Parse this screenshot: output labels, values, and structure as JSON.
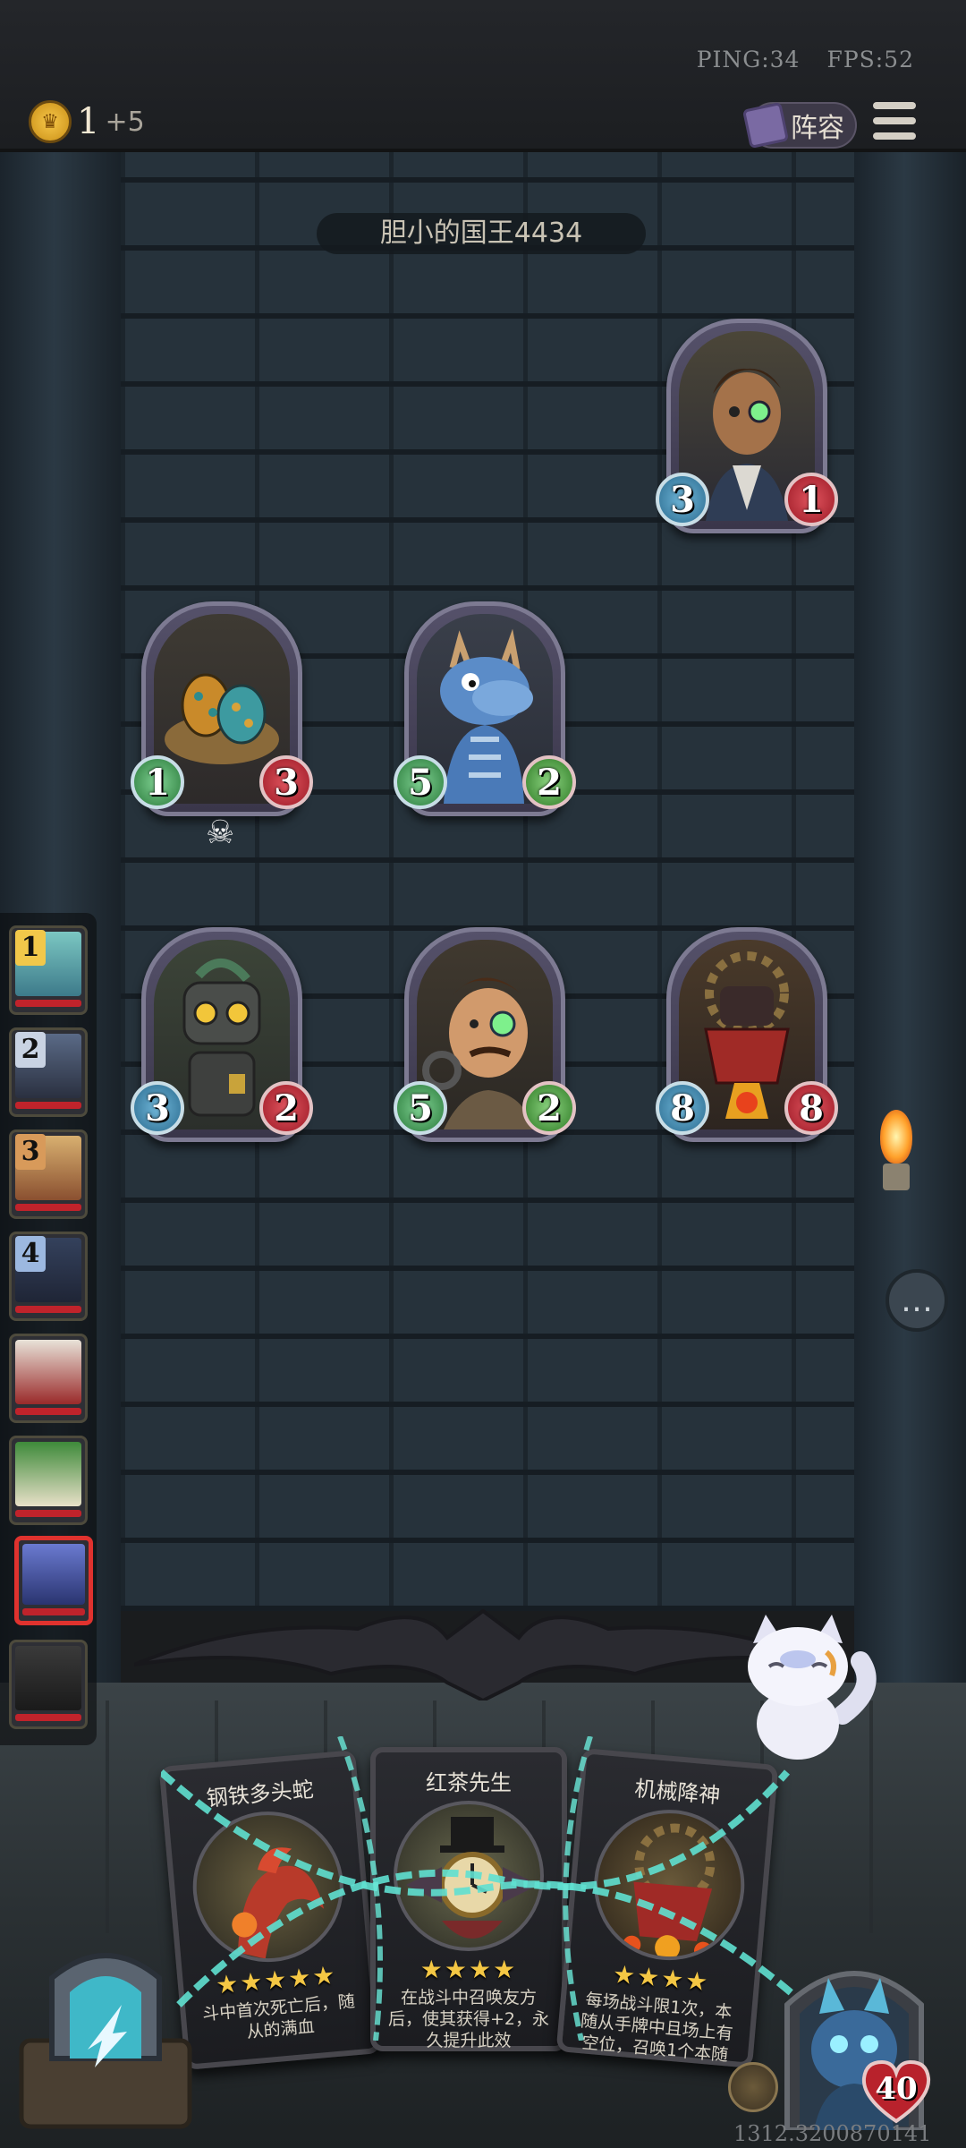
{
  "hud": {
    "ping": "PING:34",
    "fps": "FPS:52",
    "gold": "1",
    "gold_income": "+5",
    "lineup_label": "阵容"
  },
  "opponent": {
    "name": "胆小的国王4434"
  },
  "board": [
    {
      "name": "engineer",
      "attack": "3",
      "health": "1"
    },
    {
      "name": "egg",
      "attack": "1",
      "health": "3",
      "deathrattle": true
    },
    {
      "name": "blue-dragon",
      "attack": "5",
      "health": "2"
    },
    {
      "name": "robot",
      "attack": "3",
      "health": "2"
    },
    {
      "name": "mustache-man",
      "attack": "5",
      "health": "2"
    },
    {
      "name": "mech-god",
      "attack": "8",
      "health": "8"
    }
  ],
  "players": [
    {
      "rank": "1"
    },
    {
      "rank": "2"
    },
    {
      "rank": "3"
    },
    {
      "rank": "4"
    },
    {
      "rank": ""
    },
    {
      "rank": ""
    },
    {
      "rank": "",
      "active": true
    },
    {
      "rank": ""
    }
  ],
  "cards": [
    {
      "name": "钢铁多头蛇",
      "stars": "★★★★★",
      "desc": "斗中首次死亡后，随从的满血"
    },
    {
      "name": "红茶先生",
      "stars": "★★★★",
      "desc": "在战斗中召唤友方后，使其获得+2，永久提升此效"
    },
    {
      "name": "机械降神",
      "stars": "★★★★",
      "desc": "每场战斗限1次，本随从手牌中且场上有空位，召唤1个本随从"
    }
  ],
  "hero": {
    "health": "40"
  },
  "footer": {
    "coords": "1312.3200870141"
  },
  "colors": {
    "attack": "#2b6b8f",
    "health": "#9c1a26",
    "gold": "#f7c84a",
    "star": "#f4c744"
  }
}
